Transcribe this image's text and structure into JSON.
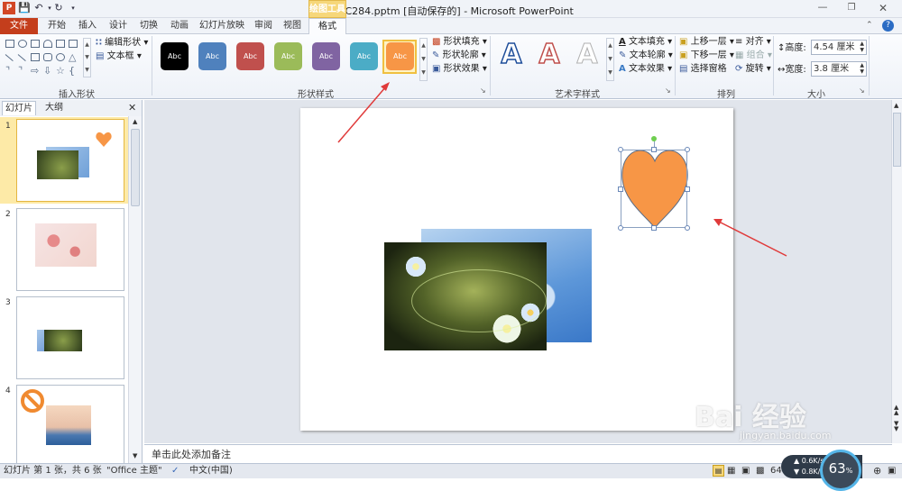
{
  "window": {
    "title": "pptC284.pptm [自动保存的] - Microsoft PowerPoint"
  },
  "contextual_tab": "绘图工具",
  "tabs": [
    "文件",
    "开始",
    "插入",
    "设计",
    "切换",
    "动画",
    "幻灯片放映",
    "审阅",
    "视图",
    "格式"
  ],
  "groups": {
    "insert_shapes": "插入形状",
    "shape_styles": "形状样式",
    "wordart_styles": "艺术字样式",
    "arrange": "排列",
    "size": "大小"
  },
  "shape_tools": {
    "edit_shape": "编辑形状",
    "text_box": "文本框"
  },
  "style_presets": [
    {
      "label": "Abc",
      "color": "#000000"
    },
    {
      "label": "Abc",
      "color": "#4f81bd"
    },
    {
      "label": "Abc",
      "color": "#c0504d"
    },
    {
      "label": "Abc",
      "color": "#9bbb59"
    },
    {
      "label": "Abc",
      "color": "#8064a2"
    },
    {
      "label": "Abc",
      "color": "#4bacc6"
    },
    {
      "label": "Abc",
      "color": "#f79646"
    }
  ],
  "shape_commands": {
    "fill": "形状填充",
    "outline": "形状轮廓",
    "effects": "形状效果"
  },
  "text_commands": {
    "fill": "文本填充",
    "outline": "文本轮廓",
    "effects": "文本效果"
  },
  "arrange_commands": {
    "bring_forward": "上移一层",
    "send_backward": "下移一层",
    "selection_pane": "选择窗格",
    "align": "对齐",
    "group": "组合",
    "rotate": "旋转"
  },
  "size": {
    "height_label": "高度:",
    "height_value": "4.54 厘米",
    "width_label": "宽度:",
    "width_value": "3.8 厘米"
  },
  "left_pane": {
    "tab_slides": "幻灯片",
    "tab_outline": "大纲",
    "slide_numbers": [
      "1",
      "2",
      "3",
      "4"
    ]
  },
  "notes_placeholder": "单击此处添加备注",
  "status": {
    "slide_info": "幻灯片 第 1 张，共 6 张",
    "theme": "\"Office 主题\"",
    "language": "中文(中国)",
    "zoom": "64",
    "net_up": "0.6K/s",
    "net_down": "0.8K/s",
    "cpu": "63",
    "cpu_unit": "%"
  },
  "watermark": {
    "brand": "Bai 经验",
    "url": "jingyan.baidu.com"
  },
  "colors": {
    "accent_tab": "#c43e1c",
    "heart_fill": "#f79646",
    "contextual": "#f0c040"
  }
}
